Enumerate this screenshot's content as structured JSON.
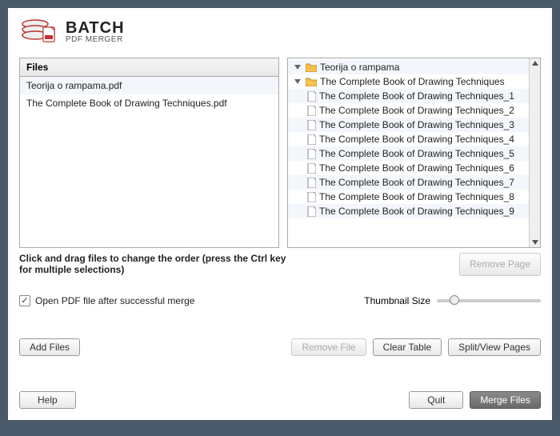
{
  "brand": {
    "top": "BATCH",
    "bottom": "PDF MERGER"
  },
  "files_header": "Files",
  "files": [
    "Teorija o rampama.pdf",
    "The Complete Book of Drawing Techniques.pdf"
  ],
  "tree": {
    "root1": "Teorija o rampama",
    "root2": "The Complete Book of Drawing Techniques",
    "pages": [
      "The Complete Book of Drawing Techniques_1",
      "The Complete Book of Drawing Techniques_2",
      "The Complete Book of Drawing Techniques_3",
      "The Complete Book of Drawing Techniques_4",
      "The Complete Book of Drawing Techniques_5",
      "The Complete Book of Drawing Techniques_6",
      "The Complete Book of Drawing Techniques_7",
      "The Complete Book of Drawing Techniques_8",
      "The Complete Book of Drawing Techniques_9"
    ]
  },
  "hint": "Click and drag files to change the order (press the Ctrl key for multiple selections)",
  "buttons": {
    "remove_page": "Remove Page",
    "add_files": "Add Files",
    "remove_file": "Remove File",
    "clear_table": "Clear Table",
    "split_view": "Split/View Pages",
    "help": "Help",
    "quit": "Quit",
    "merge": "Merge Files"
  },
  "checkbox_label": "Open PDF file after successful merge",
  "thumb_label": "Thumbnail Size"
}
